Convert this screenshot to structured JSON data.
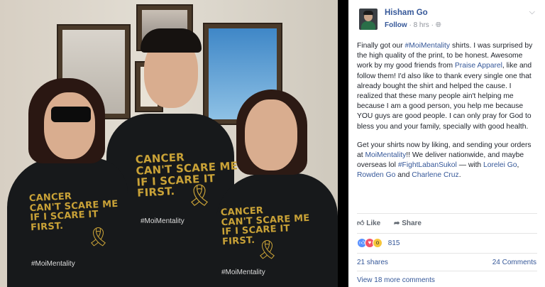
{
  "post": {
    "author": "Hisham Go",
    "follow": "Follow",
    "time": "8 hrs",
    "paragraph1_parts": [
      {
        "t": "Finally got our ",
        "link": false
      },
      {
        "t": "#MoiMentality",
        "link": true
      },
      {
        "t": " shirts. I was surprised by the high quality of the print, to be honest. Awesome work by my good friends from ",
        "link": false
      },
      {
        "t": "Praise Apparel",
        "link": true
      },
      {
        "t": ", like and follow them! I'd also like to thank every single one that already bought the shirt and helped the cause. I realized that these many people ain't helping me because I am a good person, you help me because YOU guys are good people. I can only pray for God to bless you and your family, specially with good health.",
        "link": false
      }
    ],
    "paragraph2_parts": [
      {
        "t": "Get your shirts now by liking, and sending your orders at ",
        "link": false
      },
      {
        "t": "MoiMentality",
        "link": true
      },
      {
        "t": "!! We deliver nationwide, and maybe overseas lol ",
        "link": false
      },
      {
        "t": "#FightLabanSukol",
        "link": true
      },
      {
        "t": " — with ",
        "link": false
      },
      {
        "t": "Lorelei Go",
        "link": true
      },
      {
        "t": ", ",
        "link": false
      },
      {
        "t": "Rowden Go",
        "link": true
      },
      {
        "t": " and ",
        "link": false
      },
      {
        "t": "Charlene Cruz",
        "link": true
      },
      {
        "t": ".",
        "link": false
      }
    ]
  },
  "actions": {
    "like": "Like",
    "share": "Share"
  },
  "stats": {
    "reactions": "815",
    "shares": "21 shares",
    "comments": "24 Comments",
    "more_comments": "View 18 more comments"
  },
  "photo": {
    "shirt_text": "CANCER\nCAN'T SCARE ME\nIF I SCARE IT\nFIRST.",
    "shirt_tag": "#MoiMentality"
  },
  "icons": [
    "chevron-down-icon",
    "globe-icon",
    "like-icon",
    "share-icon",
    "like-reaction-icon",
    "love-reaction-icon",
    "wow-reaction-icon"
  ],
  "colors": {
    "link": "#365899",
    "gold_print": "#c9a237",
    "shirt": "#17191b"
  }
}
